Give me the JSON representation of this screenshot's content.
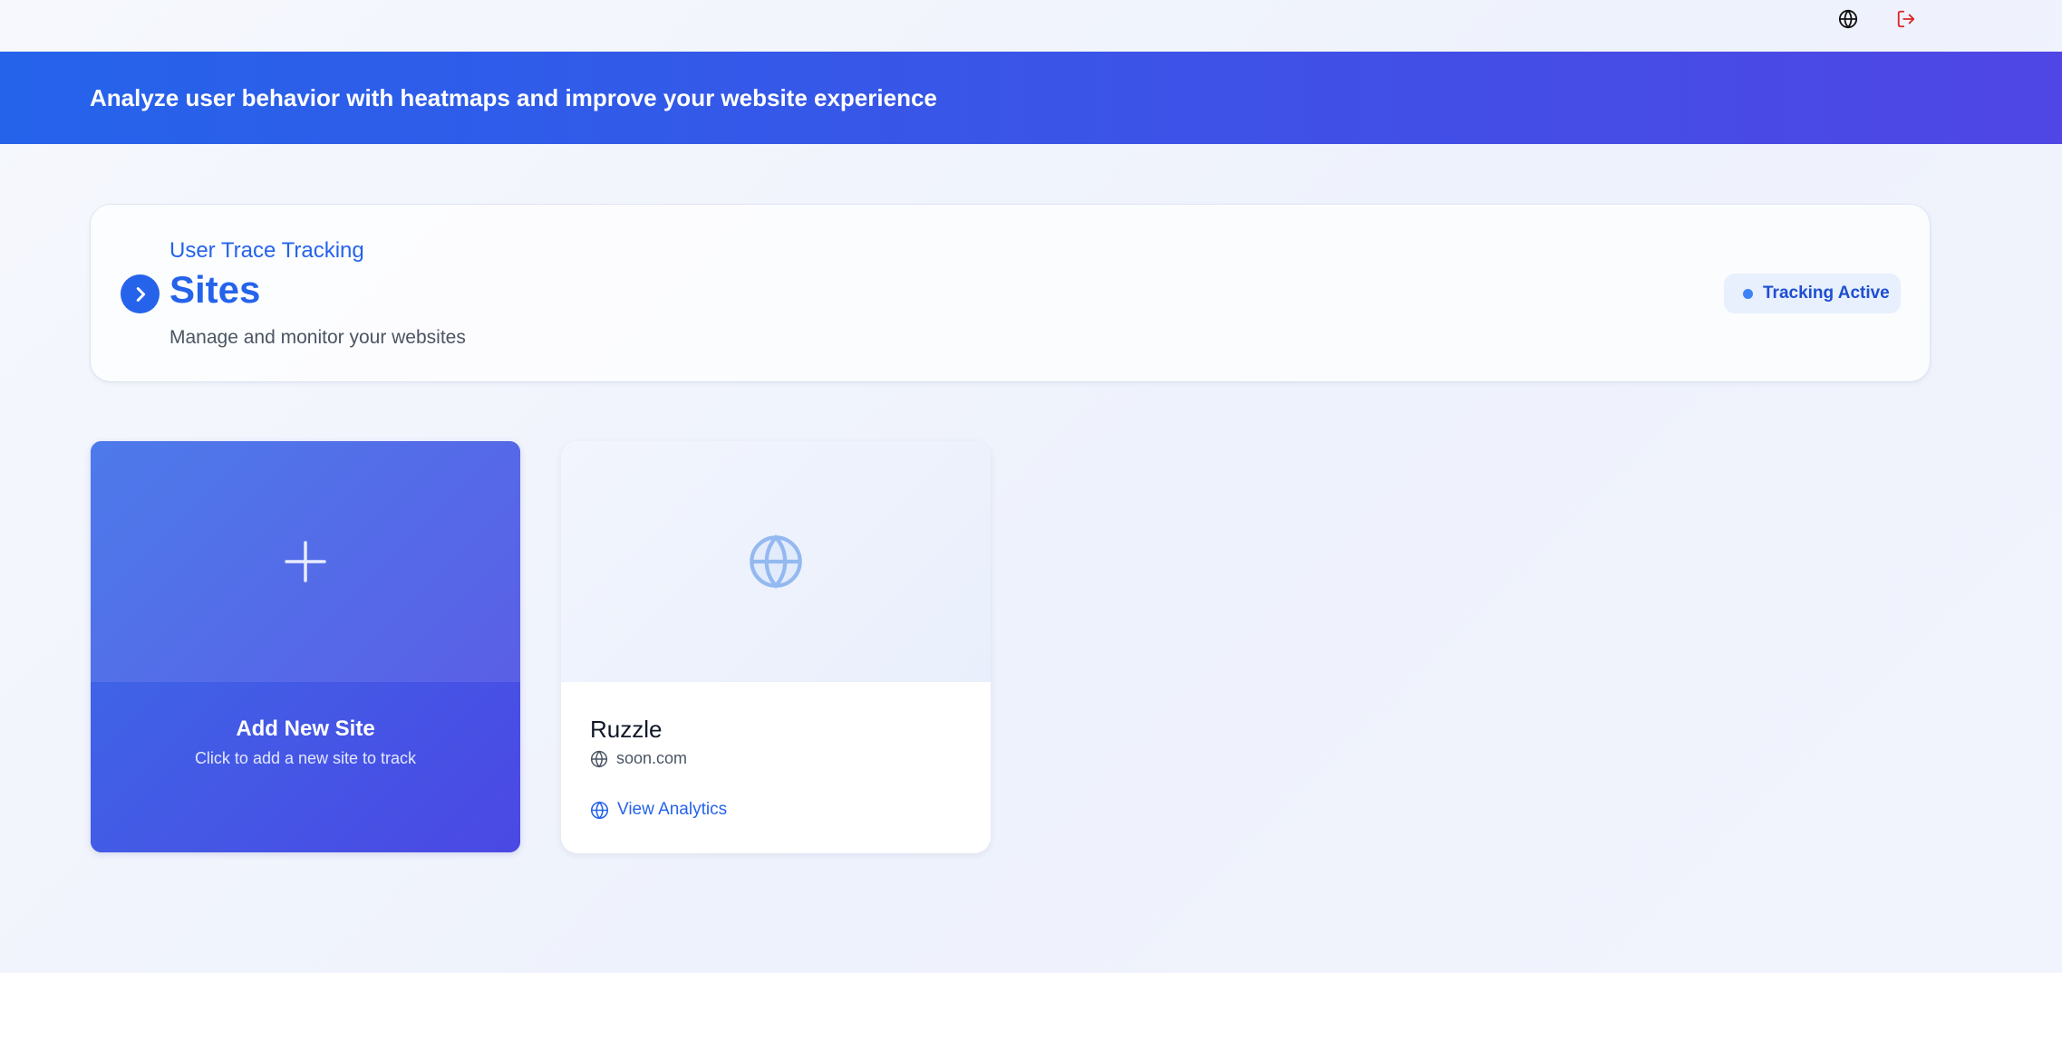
{
  "topbar": {
    "icons": [
      {
        "name": "globe-icon",
        "color": "#111111"
      },
      {
        "name": "logout-icon",
        "color": "#dc2626"
      }
    ]
  },
  "banner": {
    "text": "Analyze user behavior with heatmaps and improve your website experience",
    "gradient": [
      "#2563eb",
      "#4f46e5"
    ]
  },
  "header": {
    "eyebrow": "User Trace Tracking",
    "title": "Sites",
    "subtitle": "Manage and monitor your websites",
    "status": "Tracking Active",
    "accent": "#2563eb"
  },
  "add_card": {
    "title": "Add New Site",
    "subtitle": "Click to add a new site to track",
    "icon": "plus-icon"
  },
  "sites": [
    {
      "name": "Ruzzle",
      "domain": "soon.com",
      "link_label": "View Analytics",
      "icon": "globe-icon"
    }
  ]
}
